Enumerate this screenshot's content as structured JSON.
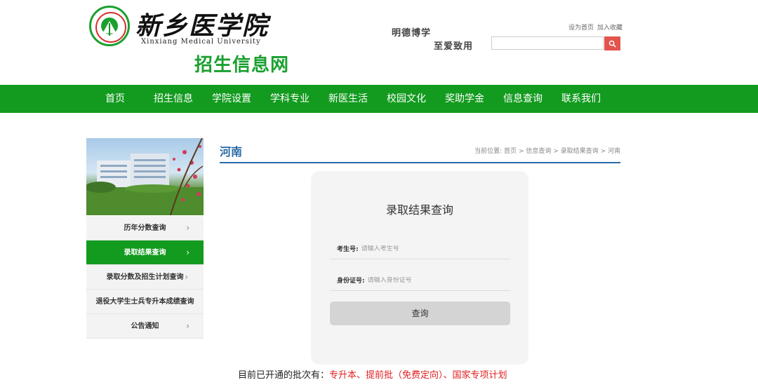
{
  "header": {
    "logo_cn": "新乡医学院",
    "logo_en": "Xinxiang Medical University",
    "site_title": "招生信息网",
    "motto_line1": "明德博学",
    "motto_line2": "至爱致用",
    "links": [
      "设为首页",
      "加入收藏"
    ],
    "search_placeholder": "",
    "colors": {
      "brand_green": "#139b1f",
      "search_red": "#e2554e"
    }
  },
  "nav": {
    "items": [
      "首页",
      "招生信息",
      "学院设置",
      "学科专业",
      "新医生活",
      "校园文化",
      "奖助学金",
      "信息查询",
      "联系我们"
    ]
  },
  "sidebar": {
    "items": [
      {
        "label": "历年分数查询",
        "chevron": "›"
      },
      {
        "label": "录取结果查询",
        "chevron": "›",
        "active": true
      },
      {
        "label": "录取分数及招生计划查询",
        "chevron": "›"
      },
      {
        "label": "退役大学生士兵专升本成绩查询",
        "chevron": ""
      },
      {
        "label": "公告通知",
        "chevron": "›"
      }
    ]
  },
  "main": {
    "title": "河南",
    "breadcrumb": {
      "prefix": "当前位置:",
      "items": [
        "首页",
        "信息查询",
        "录取结果查询",
        "河南"
      ],
      "separator": ">"
    },
    "form": {
      "title": "录取结果查询",
      "exam_label": "考生号:",
      "exam_placeholder": "请输入考生号",
      "id_label": "身份证号:",
      "id_placeholder": "请输入身份证号",
      "submit_label": "查询"
    },
    "notice": {
      "prefix": "目前已开通的批次有：",
      "batches": "专升本、提前批（免费定向）、国家专项计划"
    }
  }
}
